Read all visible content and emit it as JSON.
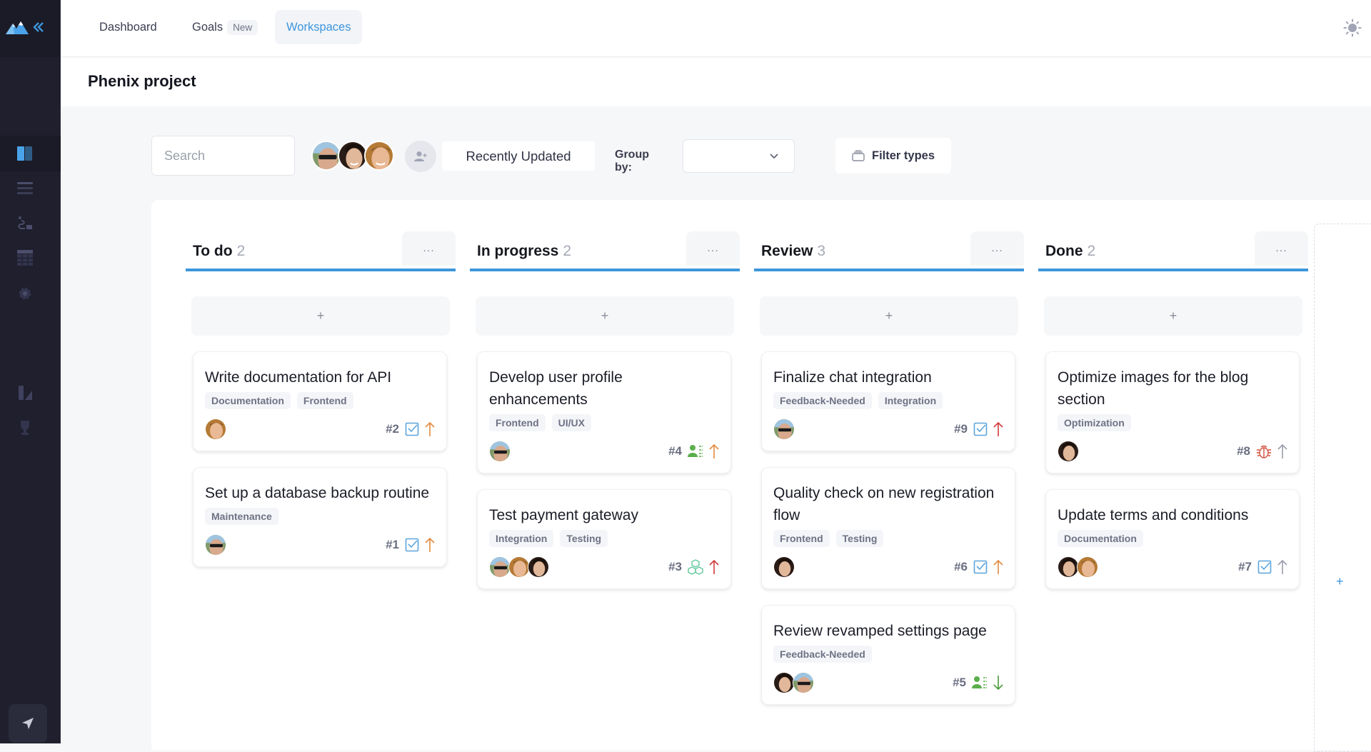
{
  "sidebar": {
    "logo_icon": "mountain-logo-icon",
    "collapse_icon": "double-chevron-left-icon",
    "items": [
      {
        "name": "board-view",
        "icon": "kanban-board-icon",
        "active": true
      },
      {
        "name": "list-view",
        "icon": "list-icon",
        "active": false
      },
      {
        "name": "roadmap-view",
        "icon": "roadmap-path-icon",
        "active": false
      },
      {
        "name": "table-view",
        "icon": "table-grid-icon",
        "active": false
      },
      {
        "name": "settings",
        "icon": "gear-icon",
        "active": false
      },
      {
        "name": "reports",
        "icon": "chart-icon",
        "active": false
      },
      {
        "name": "achievements",
        "icon": "trophy-icon",
        "active": false
      }
    ],
    "bottom_button_icon": "paper-plane-icon"
  },
  "topnav": {
    "items": [
      {
        "label": "Dashboard",
        "active": false
      },
      {
        "label": "Goals",
        "badge": "New",
        "active": false
      },
      {
        "label": "Workspaces",
        "active": true
      }
    ],
    "theme_icon": "sun-icon",
    "user_avatar": "user-avatar"
  },
  "page": {
    "title": "Phenix project"
  },
  "toolbar": {
    "search_placeholder": "Search",
    "search_value": "",
    "members": [
      "member-1",
      "member-2",
      "member-3"
    ],
    "add_member_icon": "add-user-icon",
    "sort_label": "Recently Updated",
    "group_by_label": "Group by:",
    "group_by_value": "",
    "filter_label": "Filter types"
  },
  "colors": {
    "accent": "#3d96dc",
    "sidebar_bg": "#1f1f2d",
    "priority_high": "#d23a3a",
    "priority_medium": "#e28b3f",
    "priority_low": "#4a9a3a",
    "priority_none": "#9a9dab",
    "type_task": "#5ba4dc",
    "type_story": "#5cae4c",
    "type_epic": "#5fc79a",
    "type_bug": "#d24b3a"
  },
  "columns": [
    {
      "title": "To do",
      "count": "2",
      "menu_label": "...",
      "add_label": "+",
      "cards": [
        {
          "title": "Write documentation for API",
          "tags": [
            "Documentation",
            "Frontend"
          ],
          "assignees": [
            "m3"
          ],
          "id": "#2",
          "type": "task",
          "priority": "medium"
        },
        {
          "title": "Set up a database backup routine",
          "tags": [
            "Maintenance"
          ],
          "assignees": [
            "m1"
          ],
          "id": "#1",
          "type": "task",
          "priority": "medium"
        }
      ]
    },
    {
      "title": "In progress",
      "count": "2",
      "menu_label": "...",
      "add_label": "+",
      "cards": [
        {
          "title": "Develop user profile enhancements",
          "tags": [
            "Frontend",
            "UI/UX"
          ],
          "assignees": [
            "m1"
          ],
          "id": "#4",
          "type": "story",
          "priority": "medium"
        },
        {
          "title": "Test payment gateway",
          "tags": [
            "Integration",
            "Testing"
          ],
          "assignees": [
            "m1",
            "m3",
            "m2"
          ],
          "id": "#3",
          "type": "epic",
          "priority": "high"
        }
      ]
    },
    {
      "title": "Review",
      "count": "3",
      "menu_label": "...",
      "add_label": "+",
      "cards": [
        {
          "title": "Finalize chat integration",
          "tags": [
            "Feedback-Needed",
            "Integration"
          ],
          "assignees": [
            "m1"
          ],
          "id": "#9",
          "type": "task",
          "priority": "high"
        },
        {
          "title": "Quality check on new registration flow",
          "tags": [
            "Frontend",
            "Testing"
          ],
          "assignees": [
            "m2"
          ],
          "id": "#6",
          "type": "task",
          "priority": "medium"
        },
        {
          "title": "Review revamped settings page",
          "tags": [
            "Feedback-Needed"
          ],
          "assignees": [
            "m2",
            "m1"
          ],
          "id": "#5",
          "type": "story",
          "priority": "low"
        }
      ]
    },
    {
      "title": "Done",
      "count": "2",
      "menu_label": "...",
      "add_label": "+",
      "cards": [
        {
          "title": "Optimize images for the blog section",
          "tags": [
            "Optimization"
          ],
          "assignees": [
            "m2"
          ],
          "id": "#8",
          "type": "bug",
          "priority": "none"
        },
        {
          "title": "Update terms and conditions",
          "tags": [
            "Documentation"
          ],
          "assignees": [
            "m2",
            "m3"
          ],
          "id": "#7",
          "type": "task",
          "priority": "none"
        }
      ]
    }
  ],
  "new_column_label": "+"
}
